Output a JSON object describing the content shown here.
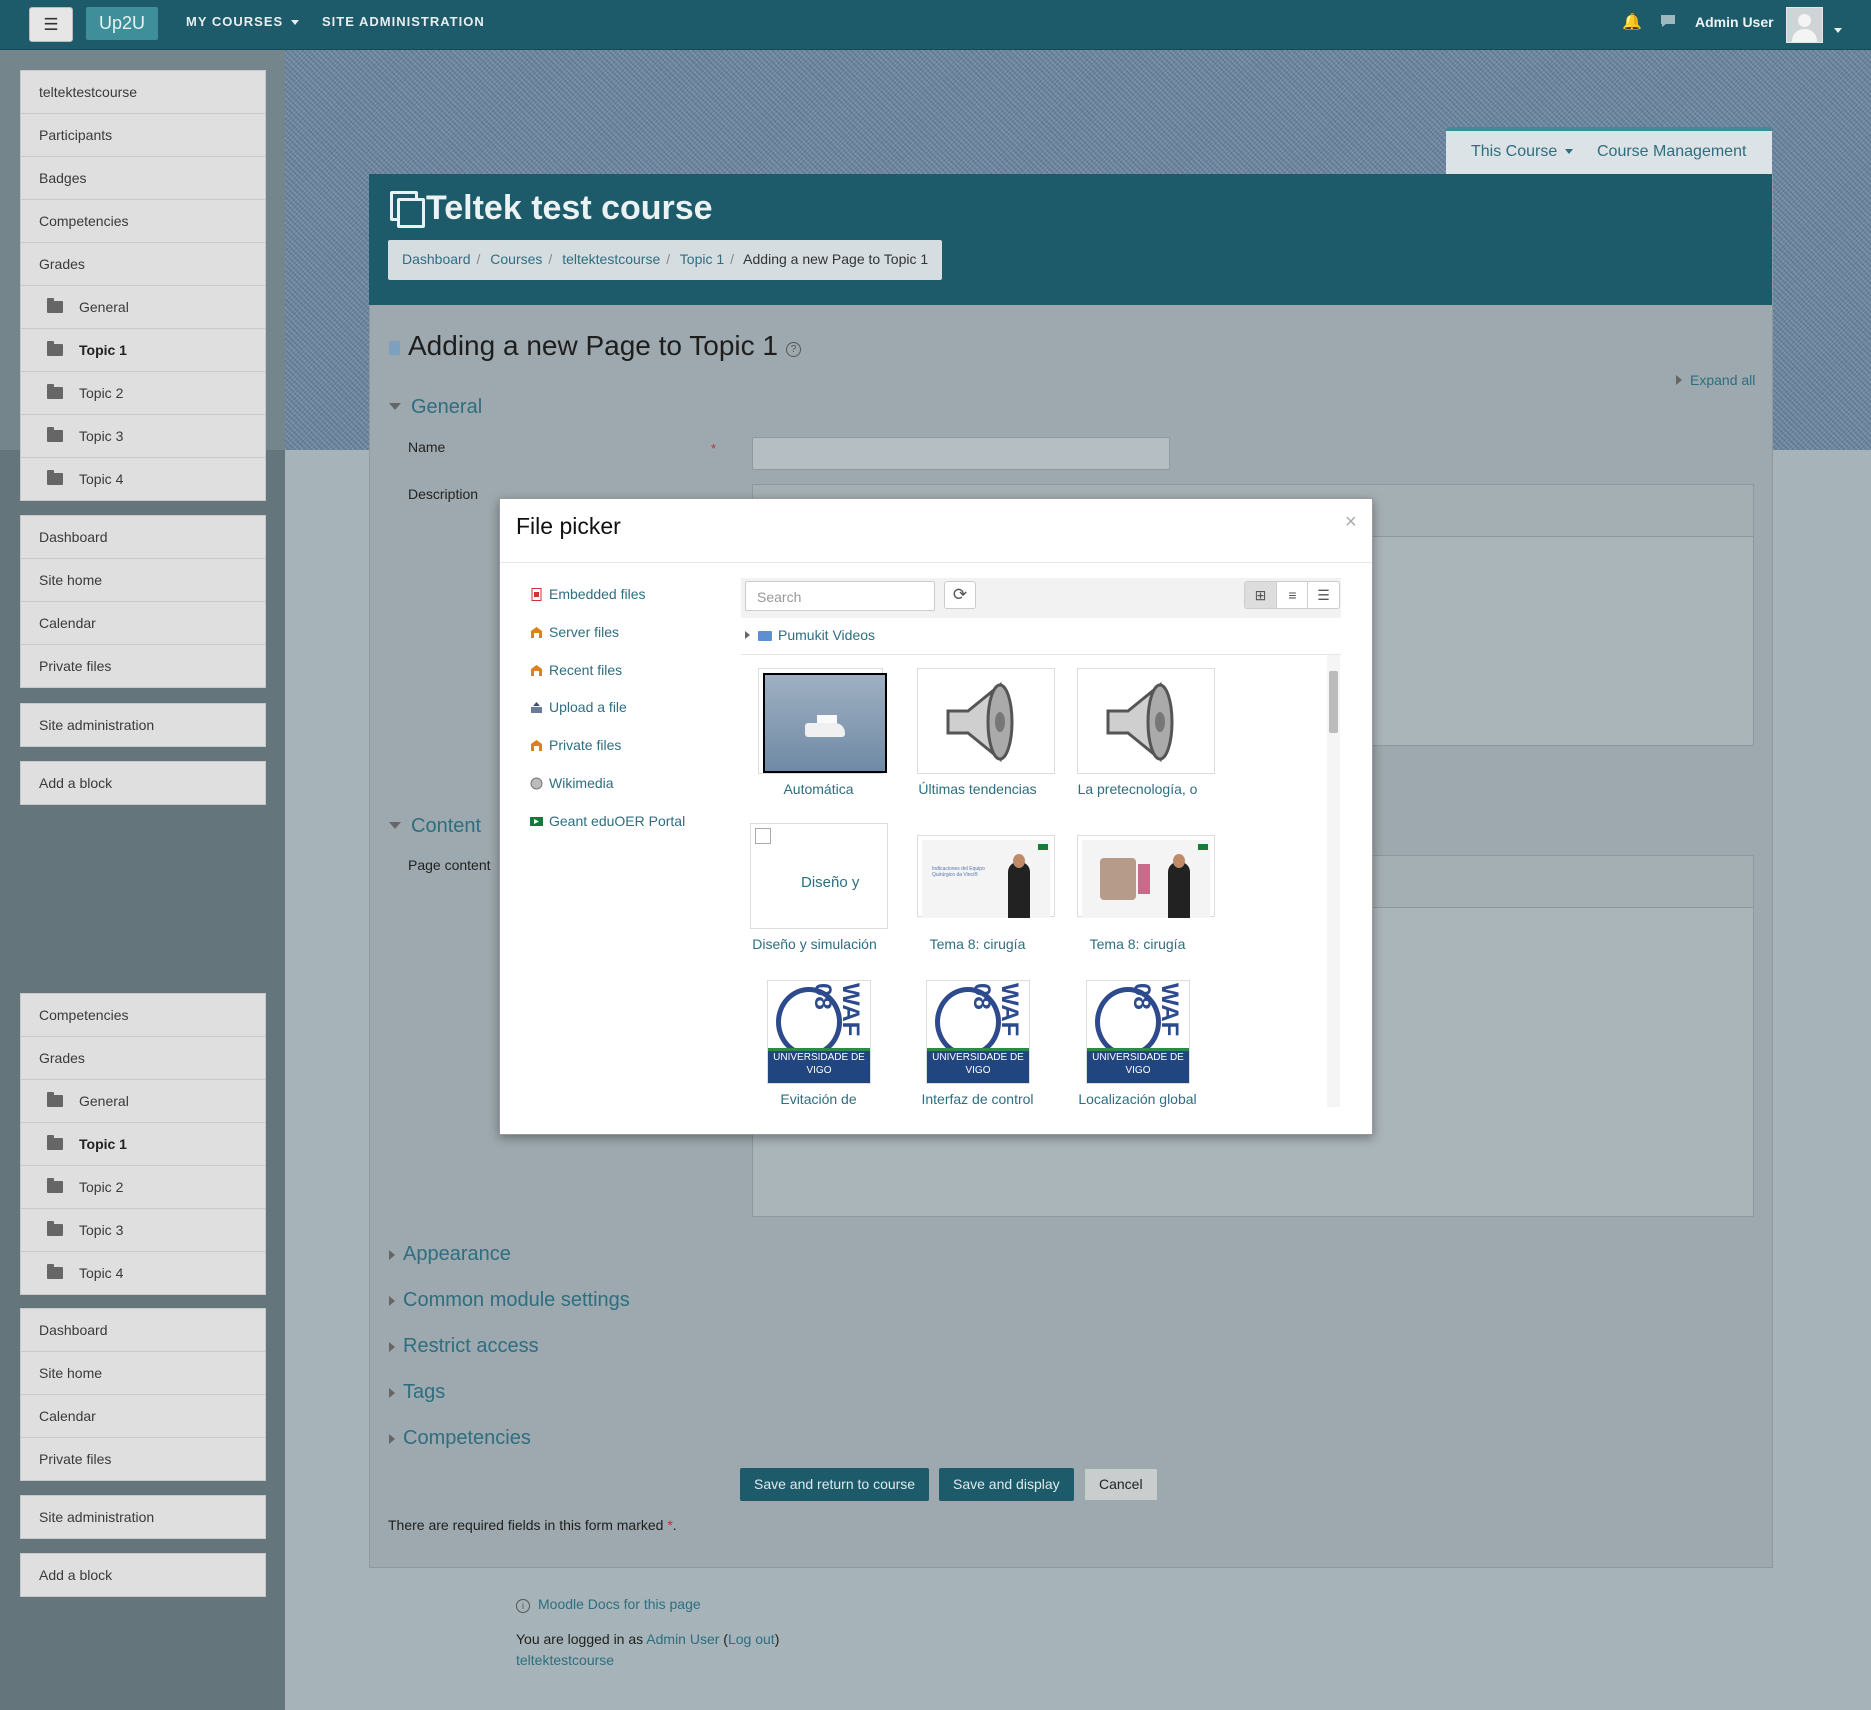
{
  "topbar": {
    "menu_icon": "hamburger-icon",
    "brand": "Up2U",
    "nav": [
      "MY COURSES",
      "SITE ADMINISTRATION"
    ],
    "notifications_icon": "bell-icon",
    "messages_icon": "chat-icon",
    "user": "Admin User"
  },
  "sidebar": {
    "course_block": [
      "teltektestcourse",
      "Participants",
      "Badges",
      "Competencies",
      "Grades"
    ],
    "sections": [
      "General",
      "Topic 1",
      "Topic 2",
      "Topic 3",
      "Topic 4"
    ],
    "nav_block": [
      "Dashboard",
      "Site home",
      "Calendar",
      "Private files"
    ],
    "site_admin": "Site administration",
    "add_block": "Add a block",
    "lower_course_block": [
      "Competencies",
      "Grades"
    ]
  },
  "course_tabs": {
    "this_course": "This Course",
    "course_management": "Course Management"
  },
  "course": {
    "title": "Teltek test course",
    "breadcrumb": [
      "Dashboard",
      "Courses",
      "teltektestcourse",
      "Topic 1",
      "Adding a new Page to Topic 1"
    ]
  },
  "page": {
    "heading": "Adding a new Page to Topic 1",
    "help": "?",
    "expand_all": "Expand all",
    "sections": {
      "general": "General",
      "content": "Content",
      "collapsed": [
        "Appearance",
        "Common module settings",
        "Restrict access",
        "Tags",
        "Competencies"
      ]
    },
    "fields": {
      "name": "Name",
      "required_mark": "*",
      "description": "Description",
      "page_content": "Page content"
    },
    "buttons": {
      "save_return": "Save and return to course",
      "save_display": "Save and display",
      "cancel": "Cancel"
    },
    "required_note": "There are required fields in this form marked",
    "required_star": "*",
    "required_end": "."
  },
  "footer": {
    "docs_link": "Moodle Docs for this page",
    "logged_in_as": "You are logged in as",
    "user": "Admin User",
    "logout": "Log out",
    "course": "teltektestcourse"
  },
  "file_picker": {
    "title": "File picker",
    "close": "×",
    "repositories": [
      {
        "label": "Embedded files",
        "icon": "embedded-files-icon"
      },
      {
        "label": "Server files",
        "icon": "server-files-icon"
      },
      {
        "label": "Recent files",
        "icon": "recent-files-icon"
      },
      {
        "label": "Upload a file",
        "icon": "upload-icon"
      },
      {
        "label": "Private files",
        "icon": "private-files-icon"
      },
      {
        "label": "Wikimedia",
        "icon": "wikimedia-icon"
      },
      {
        "label": "Geant eduOER Portal",
        "icon": "geant-icon"
      }
    ],
    "search_placeholder": "Search",
    "path_folder": "Pumukit Videos",
    "items": [
      "Automática",
      "Últimas tendencias",
      "La pretecnología, o",
      "Diseño y simulación",
      "Tema 8: cirugía",
      "Tema 8: cirugía",
      "Evitación de",
      "Interfaz de control",
      "Localización global"
    ],
    "broken_image_alt": "Diseño y",
    "logo_band": "UNIVERSIDADE DE VIGO",
    "logo_letters": "WAF 08",
    "slide_caption": "Indicaciones del Equipo Quirúrgico da Vinci®"
  },
  "colors": {
    "primary": "#1d5a6a",
    "link": "#2e6e80",
    "brand": "#3f8f9a"
  }
}
